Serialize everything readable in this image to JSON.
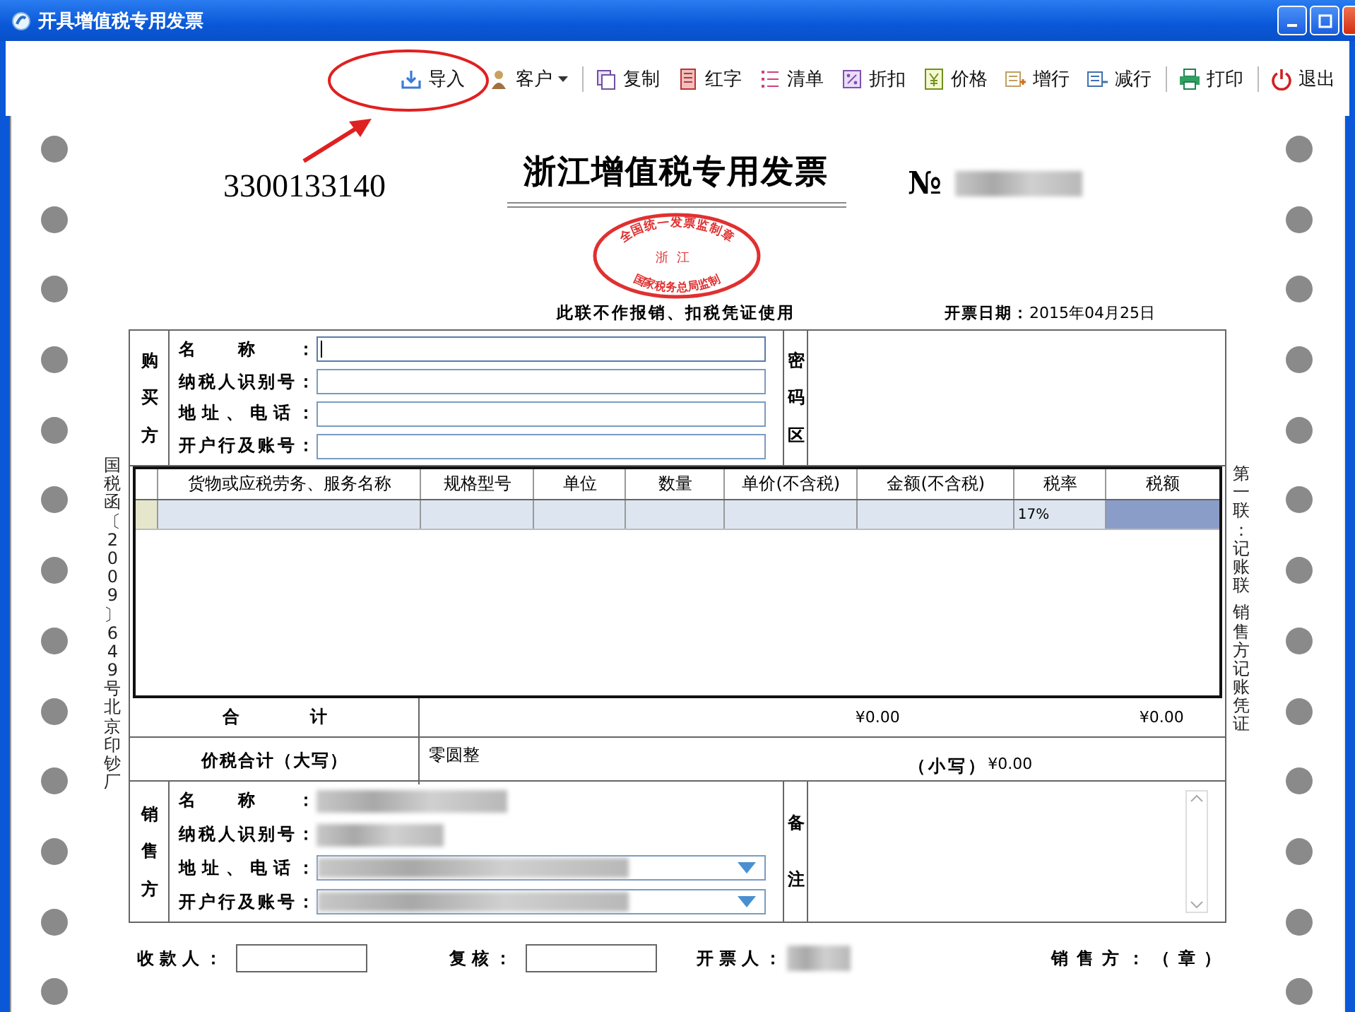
{
  "window": {
    "title": "开具增值税专用发票"
  },
  "toolbar": [
    {
      "label": "导入",
      "menu": false,
      "separator_before": false
    },
    {
      "label": "客户",
      "menu": true,
      "separator_before": false
    },
    {
      "label": "复制",
      "menu": false,
      "separator_before": true
    },
    {
      "label": "红字",
      "menu": false,
      "separator_before": false
    },
    {
      "label": "清单",
      "menu": false,
      "separator_before": false
    },
    {
      "label": "折扣",
      "menu": false,
      "separator_before": false
    },
    {
      "label": "价格",
      "menu": false,
      "separator_before": false
    },
    {
      "label": "增行",
      "menu": false,
      "separator_before": false
    },
    {
      "label": "减行",
      "menu": false,
      "separator_before": false
    },
    {
      "label": "打印",
      "menu": false,
      "separator_before": true
    },
    {
      "label": "退出",
      "menu": false,
      "separator_before": true
    }
  ],
  "invoice": {
    "code": "3300133140",
    "title": "浙江增值税专用发票",
    "number_mark": "№",
    "notice": "此联不作报销、扣税凭证使用",
    "date_label": "开票日期：",
    "date": "2015年04月25日",
    "seal": {
      "top": "全国统一发票监制章",
      "middle": "浙江",
      "bottom": "国家税务总局监制"
    },
    "side_notes": {
      "left": "国税函〔2009〕649号北京印钞厂",
      "right": [
        "第一联：记账联",
        "销售方记账凭证"
      ]
    },
    "buyer": {
      "heading": "购买方",
      "fields": [
        {
          "label": "名称：",
          "focused": true
        },
        {
          "label": "纳税人识别号：",
          "focused": false
        },
        {
          "label": "地址、电话：",
          "focused": false
        },
        {
          "label": "开户行及账号：",
          "focused": false
        }
      ],
      "cipher_heading": "密码区"
    },
    "items": {
      "columns": [
        "货物或应税劳务、服务名称",
        "规格型号",
        "单位",
        "数量",
        "单价(不含税)",
        "金额(不含税)",
        "税率",
        "税额"
      ],
      "rows": [
        {
          "tax_rate": "17%",
          "selected": true
        }
      ]
    },
    "totals": {
      "label": "合计",
      "amount": "¥0.00",
      "tax": "¥0.00"
    },
    "total_with_tax": {
      "label": "价税合计（大写）",
      "words": "零圆整",
      "figure_label": "（小写）",
      "figure": "¥0.00"
    },
    "seller": {
      "heading": "销售方",
      "fields": [
        {
          "label": "名称：",
          "kind": "text"
        },
        {
          "label": "纳税人识别号：",
          "kind": "text"
        },
        {
          "label": "地址、电话：",
          "kind": "dropdown"
        },
        {
          "label": "开户行及账号：",
          "kind": "dropdown"
        }
      ],
      "remarks_heading": "备注"
    },
    "footer": {
      "payee_label": "收款人：",
      "reviewer_label": "复核：",
      "issuer_label": "开票人：",
      "seller_stamp": "销售方：（章）"
    }
  }
}
